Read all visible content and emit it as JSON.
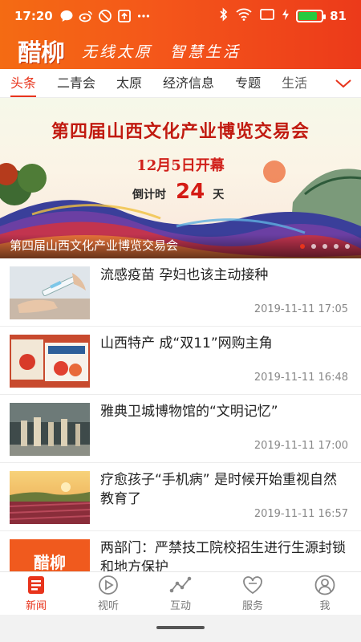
{
  "status_bar": {
    "time": "17:20",
    "battery": "81",
    "battery_level_pct": 81,
    "left_icons": [
      "chat-icon",
      "weibo-icon",
      "blocked-icon",
      "upload-icon",
      "more-dots-icon"
    ],
    "right_icons": [
      "bluetooth-icon",
      "wifi-icon",
      "screen-icon",
      "charging-icon"
    ]
  },
  "brand": {
    "logo": "醋柳",
    "slogan_1": "无线太原",
    "slogan_2": "智慧生活"
  },
  "tabs": [
    {
      "label": "头条",
      "active": true
    },
    {
      "label": "二青会",
      "active": false
    },
    {
      "label": "太原",
      "active": false
    },
    {
      "label": "经济信息",
      "active": false
    },
    {
      "label": "专题",
      "active": false
    },
    {
      "label": "生活",
      "active": false
    }
  ],
  "banner": {
    "title": "第四届山西文化产业博览交易会",
    "subtitle": "12月5日开幕",
    "countdown_prefix": "倒计时",
    "countdown_number": "24",
    "countdown_suffix": "天",
    "caption": "第四届山西文化产业博览交易会",
    "slide_count": 5,
    "active_slide": 1
  },
  "news": [
    {
      "title": "流感疫苗 孕妇也该主动接种",
      "time": "2019-11-11 17:05",
      "thumb": "vaccine"
    },
    {
      "title": "山西特产 成“双11”网购主角",
      "time": "2019-11-11 16:48",
      "thumb": "products"
    },
    {
      "title": "雅典卫城博物馆的“文明记忆”",
      "time": "2019-11-11 17:00",
      "thumb": "museum"
    },
    {
      "title": "疗愈孩子“手机病” 是时候开始重视自然教育了",
      "time": "2019-11-11 16:57",
      "thumb": "field"
    },
    {
      "title": "两部门：严禁技工院校招生进行生源封锁和地方保护",
      "time": "",
      "thumb": "logo",
      "thumb_text": "醋柳"
    }
  ],
  "bottom_nav": [
    {
      "label": "新闻",
      "icon": "news-icon",
      "active": true
    },
    {
      "label": "视听",
      "icon": "play-icon",
      "active": false
    },
    {
      "label": "互动",
      "icon": "interaction-icon",
      "active": false
    },
    {
      "label": "服务",
      "icon": "heart-icon",
      "active": false
    },
    {
      "label": "我",
      "icon": "profile-icon",
      "active": false
    }
  ],
  "colors": {
    "accent": "#e8341c",
    "header_start": "#f46b13",
    "header_end": "#ec3a1a"
  }
}
